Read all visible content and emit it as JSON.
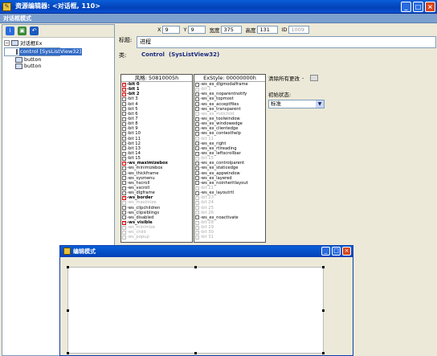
{
  "title": "资源编辑器: <对话框, 110>",
  "window_buttons": [
    "_",
    "□",
    "×"
  ],
  "subtitle": "对话框模式",
  "tree": {
    "root": "对话框Ex",
    "items": [
      "control [SysListView32]",
      "button",
      "button"
    ]
  },
  "props": {
    "x_label": "X",
    "x": "9",
    "y_label": "Y",
    "y": "9",
    "w_label": "宽度",
    "w": "375",
    "h_label": "高度",
    "h": "131",
    "id_label": "ID",
    "id": "1009",
    "title_label": "标题:",
    "title_value": "进程",
    "class_label": "类:",
    "class_a": "Control",
    "class_b": "(SysListView32)"
  },
  "style_panel": {
    "header": "风格: 50810005h",
    "items": [
      {
        "t": "-bit 0",
        "s": "on"
      },
      {
        "t": "-bit 1",
        "s": "on"
      },
      {
        "t": "-bit 2",
        "s": "on"
      },
      {
        "t": "-bit 3",
        "s": "off"
      },
      {
        "t": "-bit 4",
        "s": "off"
      },
      {
        "t": "-bit 5",
        "s": "off"
      },
      {
        "t": "-bit 6",
        "s": "off"
      },
      {
        "t": "-bit 7",
        "s": "off"
      },
      {
        "t": "-bit 8",
        "s": "off"
      },
      {
        "t": "-bit 9",
        "s": "off"
      },
      {
        "t": "-bit 10",
        "s": "off"
      },
      {
        "t": "-bit 11",
        "s": "off"
      },
      {
        "t": "-bit 12",
        "s": "off"
      },
      {
        "t": "-bit 13",
        "s": "off"
      },
      {
        "t": "-bit 14",
        "s": "off"
      },
      {
        "t": "-bit 15",
        "s": "off"
      },
      {
        "t": "-ws_maximizebox",
        "s": "on"
      },
      {
        "t": "-ws_minimizebox",
        "s": "off"
      },
      {
        "t": "-ws_thickframe",
        "s": "off"
      },
      {
        "t": "-ws_sysmenu",
        "s": "off"
      },
      {
        "t": "-ws_hscroll",
        "s": "off"
      },
      {
        "t": "-ws_vscroll",
        "s": "off"
      },
      {
        "t": "-ws_dlgframe",
        "s": "off"
      },
      {
        "t": "-ws_border",
        "s": "on"
      },
      {
        "t": "-ws_maximize",
        "s": "dim"
      },
      {
        "t": "-ws_clipchildren",
        "s": "off"
      },
      {
        "t": "-ws_clipsiblings",
        "s": "off"
      },
      {
        "t": "-ws_disabled",
        "s": "off"
      },
      {
        "t": "-ws_visible",
        "s": "on"
      },
      {
        "t": "-ws_minimize",
        "s": "dim"
      },
      {
        "t": "-ws_child",
        "s": "dim"
      },
      {
        "t": "-ws_popup",
        "s": "dim"
      }
    ]
  },
  "exstyle_panel": {
    "header": "ExStyle: 00000000h",
    "items": [
      {
        "t": "-ws_ex_dlgmodalframe",
        "s": "off"
      },
      {
        "t": "-bit 1",
        "s": "dim"
      },
      {
        "t": "-ws_ex_noparentnotify",
        "s": "off"
      },
      {
        "t": "-ws_ex_topmost",
        "s": "off"
      },
      {
        "t": "-ws_ex_acceptfiles",
        "s": "off"
      },
      {
        "t": "-ws_ex_transparent",
        "s": "off"
      },
      {
        "t": "-ws_ex_mdichild",
        "s": "dim"
      },
      {
        "t": "-ws_ex_toolwindow",
        "s": "off"
      },
      {
        "t": "-ws_ex_windowedge",
        "s": "off"
      },
      {
        "t": "-ws_ex_clientedge",
        "s": "off"
      },
      {
        "t": "-ws_ex_contexthelp",
        "s": "off"
      },
      {
        "t": "-bit 11",
        "s": "dim"
      },
      {
        "t": "-ws_ex_right",
        "s": "off"
      },
      {
        "t": "-ws_ex_rtlreading",
        "s": "off"
      },
      {
        "t": "-ws_ex_leftscrollbar",
        "s": "off"
      },
      {
        "t": "-bit 15",
        "s": "dim"
      },
      {
        "t": "-ws_ex_controlparent",
        "s": "off"
      },
      {
        "t": "-ws_ex_staticedge",
        "s": "off"
      },
      {
        "t": "-ws_ex_appwindow",
        "s": "off"
      },
      {
        "t": "-ws_ex_layered",
        "s": "off"
      },
      {
        "t": "-ws_ex_noinheritlayout",
        "s": "off"
      },
      {
        "t": "-bit 21",
        "s": "dim"
      },
      {
        "t": "-ws_ex_layoutrtl",
        "s": "off"
      },
      {
        "t": "-bit 23",
        "s": "dim"
      },
      {
        "t": "-bit 24",
        "s": "dim"
      },
      {
        "t": "-bit 25",
        "s": "dim"
      },
      {
        "t": "-bit 26",
        "s": "dim"
      },
      {
        "t": "-ws_ex_noactivate",
        "s": "off"
      },
      {
        "t": "-bit 28",
        "s": "dim"
      },
      {
        "t": "-bit 29",
        "s": "dim"
      },
      {
        "t": "-bit 30",
        "s": "dim"
      },
      {
        "t": "-bit 31",
        "s": "dim"
      }
    ]
  },
  "options": {
    "clear_changes": "清除所有更改",
    "clear_changes_marker": "-",
    "initial_state_label": "初始状态:",
    "initial_state_value": "标准",
    "dropdown_arrow": "▼"
  },
  "edit_window": {
    "title": "编辑模式",
    "buttons": [
      "_",
      "□",
      "×"
    ]
  },
  "colors": {
    "titlebar": "#0a52d4",
    "subbar": "#7b9fcf",
    "window_bg": "#ece9d8",
    "close_button": "#d8461c"
  }
}
